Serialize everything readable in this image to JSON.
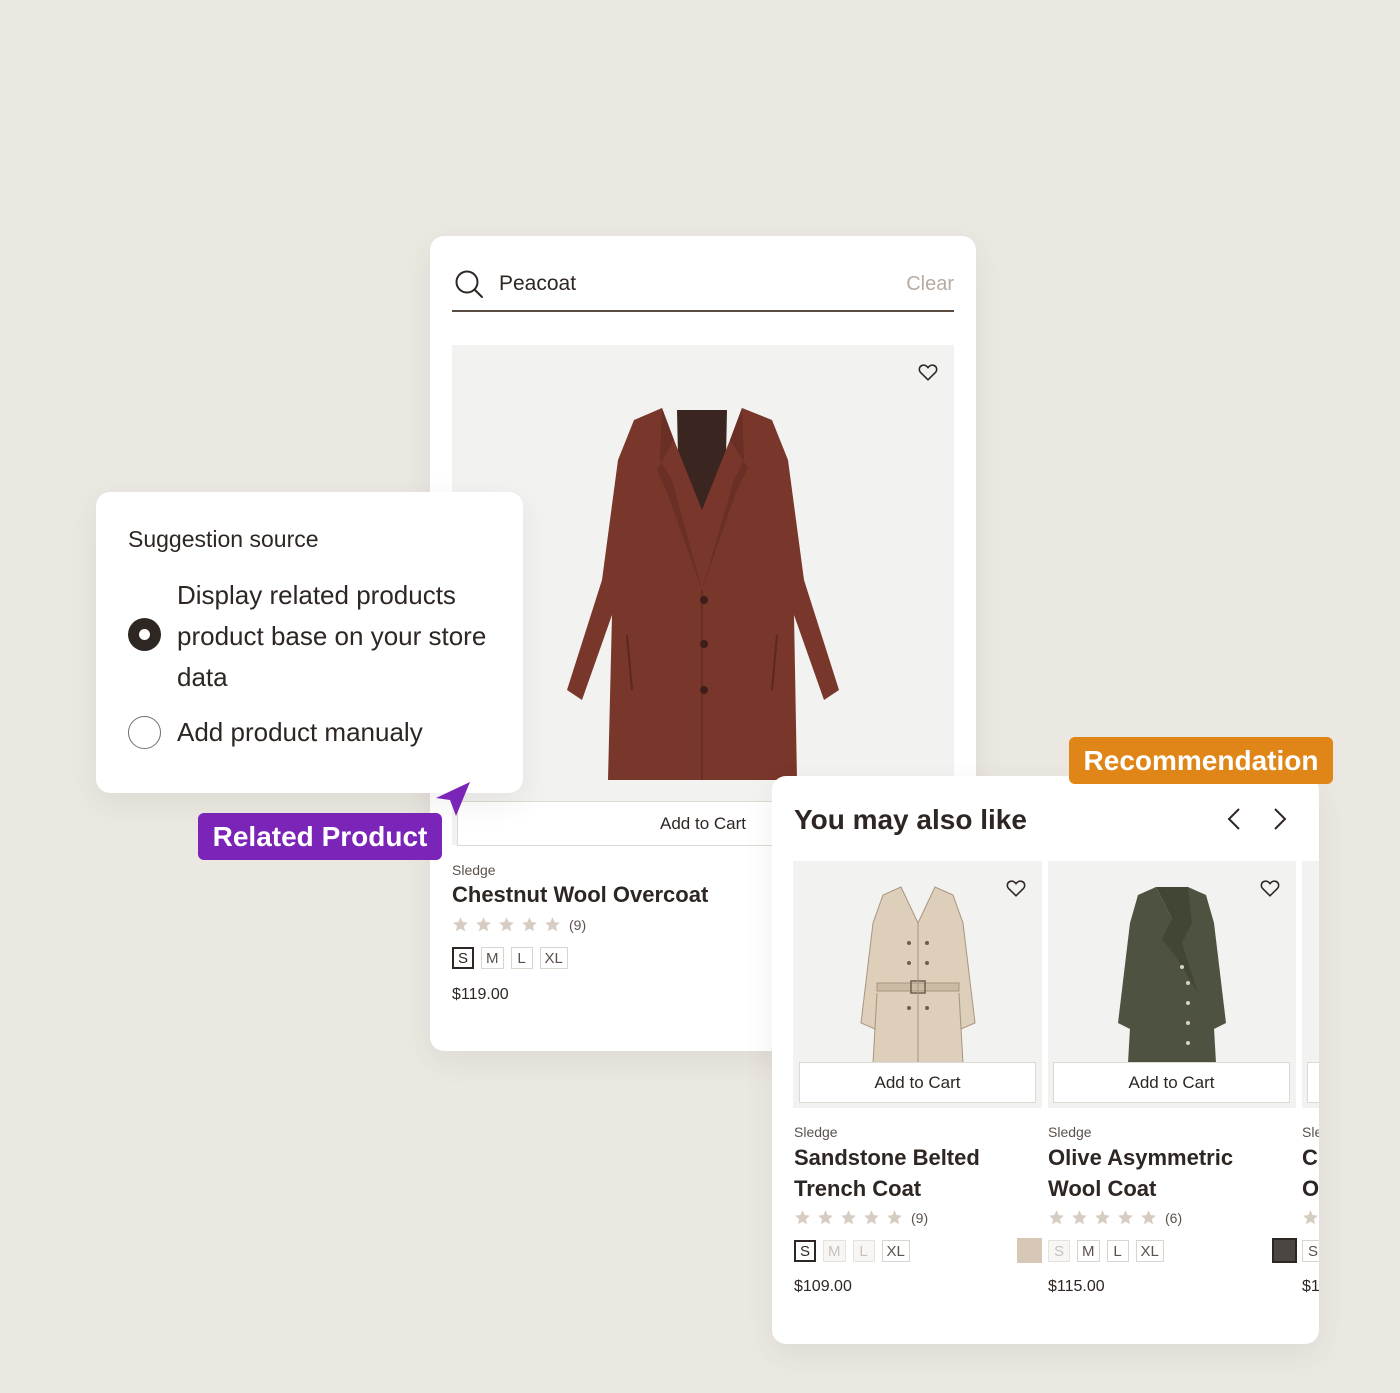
{
  "search": {
    "query": "Peacoat",
    "clear_label": "Clear"
  },
  "featured": {
    "add_to_cart": "Add to Cart",
    "brand": "Sledge",
    "name": "Chestnut Wool Overcoat",
    "rating_count": "(9)",
    "rating": 0,
    "sizes": [
      "S",
      "M",
      "L",
      "XL"
    ],
    "selected_size": "S",
    "price": "$119.00",
    "color": "#74342a"
  },
  "suggestion": {
    "title": "Suggestion source",
    "option_1": "Display related products product base on your store data",
    "option_2": "Add product manualy",
    "selected": "option_1"
  },
  "labels": {
    "related": "Related Product",
    "recommendation": "Recommendation",
    "related_color": "#7b24b8",
    "recommendation_color": "#e08618"
  },
  "recommendations": {
    "heading": "You may also like",
    "items": [
      {
        "add_to_cart": "Add to Cart",
        "brand": "Sledge",
        "name_line1": "Sandstone Belted",
        "name_line2": "Trench Coat",
        "rating_count": "(9)",
        "sizes": [
          "S",
          "M",
          "L",
          "XL"
        ],
        "price": "$109.00",
        "color": "#dcccb6"
      },
      {
        "add_to_cart": "Add to Cart",
        "brand": "Sledge",
        "name_line1": "Olive Asymmetric",
        "name_line2": "Wool Coat",
        "rating_count": "(6)",
        "sizes": [
          "S",
          "M",
          "L",
          "XL"
        ],
        "price": "$115.00",
        "color": "#4e5341",
        "swatch": "#d6c7b6"
      },
      {
        "brand": "Sle",
        "name_line1": "C",
        "name_line2": "O",
        "sizes": [
          "S"
        ],
        "price": "$1",
        "swatch": "#4a4642"
      }
    ]
  }
}
